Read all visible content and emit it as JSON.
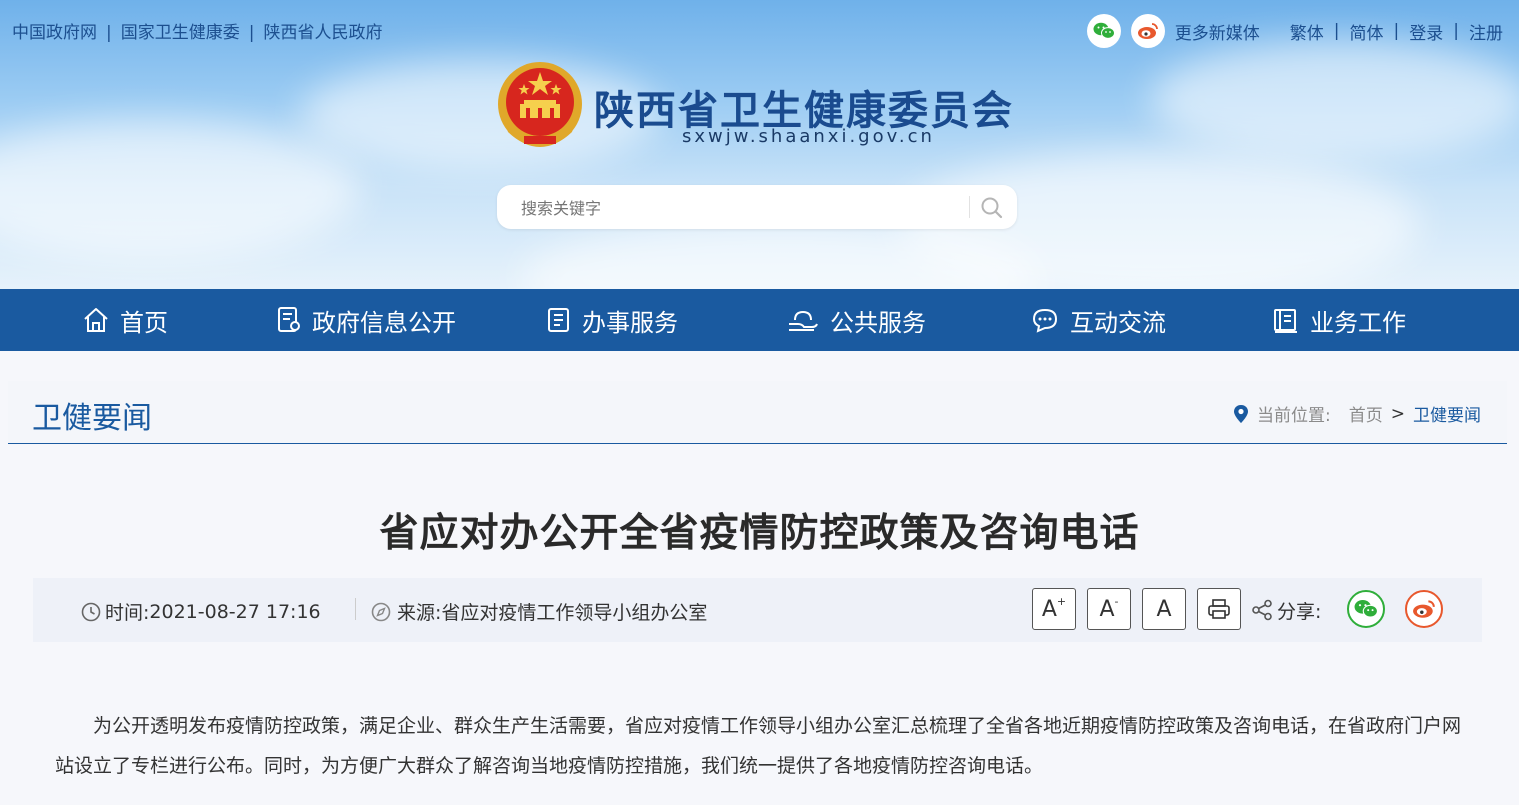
{
  "top_links": [
    "中国政府网",
    "国家卫生健康委",
    "陕西省人民政府"
  ],
  "top_right": {
    "more_media": "更多新媒体",
    "traditional": "繁体",
    "simplified": "简体",
    "login": "登录",
    "register": "注册"
  },
  "site": {
    "title": "陕西省卫生健康委员会",
    "domain": "sxwjw.shaanxi.gov.cn"
  },
  "search": {
    "placeholder": "搜索关键字"
  },
  "nav": [
    {
      "label": "首页",
      "icon": "home-icon"
    },
    {
      "label": "政府信息公开",
      "icon": "document-icon"
    },
    {
      "label": "办事服务",
      "icon": "clipboard-icon"
    },
    {
      "label": "公共服务",
      "icon": "hand-service-icon"
    },
    {
      "label": "互动交流",
      "icon": "chat-icon"
    },
    {
      "label": "业务工作",
      "icon": "book-icon"
    }
  ],
  "section": {
    "title": "卫健要闻",
    "location_label": "当前位置:",
    "breadcrumb_home": "首页",
    "breadcrumb_sep": ">",
    "breadcrumb_current": "卫健要闻"
  },
  "article": {
    "title": "省应对办公开全省疫情防控政策及咨询电话",
    "time_label": "时间:",
    "time_value": "2021-08-27 17:16",
    "source_label": "来源:",
    "source_value": "省应对疫情工作领导小组办公室",
    "font_large": "A",
    "font_small": "A",
    "font_normal": "A",
    "share_label": "分享:",
    "paragraph": "为公开透明发布疫情防控政策，满足企业、群众生产生活需要，省应对疫情工作领导小组办公室汇总梳理了全省各地近期疫情防控政策及咨询电话，在省政府门户网站设立了专栏进行公布。同时，为方便广大群众了解咨询当地疫情防控措施，我们统一提供了各地疫情防控咨询电话。"
  },
  "colors": {
    "nav_bg": "#1a5aa0",
    "accent": "#1a5aa0",
    "wechat": "#2fae3a",
    "weibo": "#e8582d"
  }
}
